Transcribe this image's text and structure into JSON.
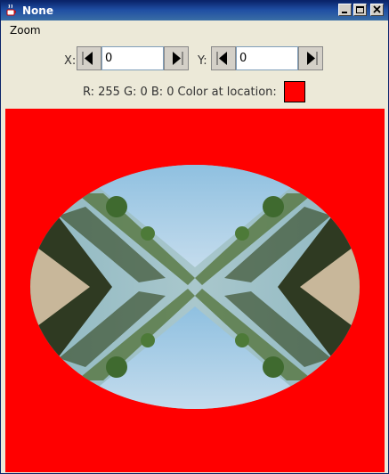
{
  "window": {
    "title": "None",
    "app_icon": "java-cup-icon",
    "controls": [
      "minimize-icon",
      "maximize-icon",
      "close-icon"
    ]
  },
  "menu": {
    "items": [
      {
        "label": "Zoom"
      }
    ]
  },
  "controls": {
    "x": {
      "label": "X:",
      "value": "0"
    },
    "y": {
      "label": "Y:",
      "value": "0"
    },
    "prev_icon": "left-triangle-icon",
    "next_icon": "right-triangle-icon"
  },
  "color_info": {
    "r_label": "R: 255",
    "g_label": "G: 0",
    "b_label": "B: 0",
    "location_label": "Color at location:",
    "swatch_color": "#ff0000"
  },
  "canvas": {
    "background_color": "#ff0000",
    "content": "mirrored-landscape-image"
  }
}
